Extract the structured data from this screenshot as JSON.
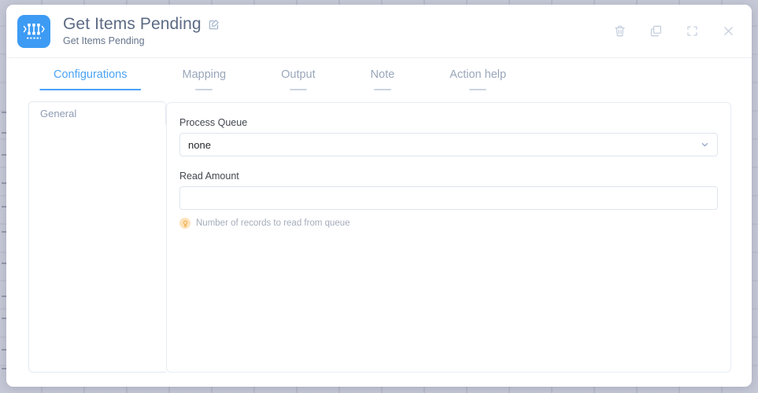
{
  "window": {
    "title": "Get Items Pending",
    "subtitle": "Get Items Pending",
    "app_icon_name": "process-queue-icon",
    "edit_icon_name": "edit-pencil-icon",
    "accent_color": "#4aa3f5",
    "icon_bg_color": "#3d9bf4"
  },
  "header_actions": [
    {
      "name": "delete-button",
      "icon": "trash-icon",
      "label": "Delete"
    },
    {
      "name": "duplicate-button",
      "icon": "copy-icon",
      "label": "Duplicate"
    },
    {
      "name": "fullscreen-button",
      "icon": "expand-icon",
      "label": "Fullscreen"
    },
    {
      "name": "close-button",
      "icon": "close-icon",
      "label": "Close"
    }
  ],
  "tabs": [
    {
      "label": "Configurations",
      "active": true
    },
    {
      "label": "Mapping",
      "active": false
    },
    {
      "label": "Output",
      "active": false
    },
    {
      "label": "Note",
      "active": false
    },
    {
      "label": "Action help",
      "active": false
    }
  ],
  "sidebar": {
    "items": [
      {
        "label": "General",
        "active": true
      }
    ]
  },
  "form": {
    "fields": [
      {
        "label": "Process Queue",
        "type": "select",
        "value": "none",
        "placeholder": "",
        "options": [
          "none"
        ],
        "hint": ""
      },
      {
        "label": "Read Amount",
        "type": "text",
        "value": "",
        "placeholder": "",
        "hint": "Number of records to read from queue",
        "hint_icon": "lightbulb-icon",
        "hint_icon_color": "#f0a63c"
      }
    ]
  }
}
